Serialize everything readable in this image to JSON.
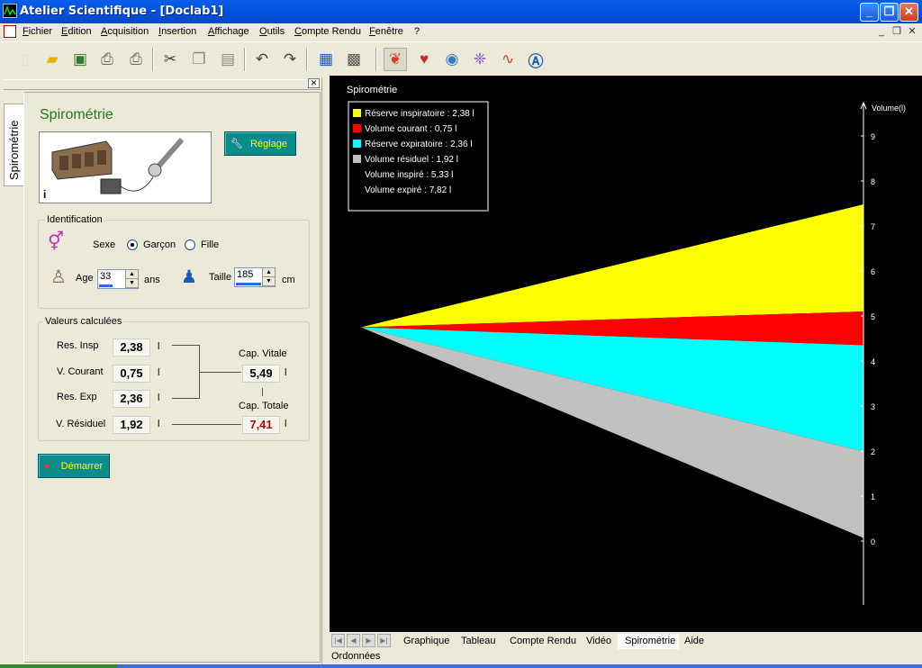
{
  "window": {
    "title": "Atelier Scientifique - [Doclab1]"
  },
  "menu": [
    "Fichier",
    "Edition",
    "Acquisition",
    "Insertion",
    "Affichage",
    "Outils",
    "Compte Rendu",
    "Fenêtre",
    "?"
  ],
  "toolbar": {
    "icons": [
      "new-document-icon",
      "open-folder-icon",
      "save-icon",
      "print-icon",
      "print-preview-icon",
      "cut-icon",
      "copy-icon",
      "paste-icon",
      "undo-icon",
      "redo-icon",
      "chart-icon",
      "table-icon",
      "lungs-icon",
      "heart-icon",
      "eye-icon",
      "molecule-icon",
      "signal-icon",
      "text-icon"
    ]
  },
  "panel": {
    "tab_label": "Spirométrie",
    "title": "Spirométrie",
    "reglage_label": "Réglage",
    "demarrer_label": "Démarrer"
  },
  "identification": {
    "group_label": "Identification",
    "sexe_label": "Sexe",
    "options": [
      "Garçon",
      "Fille"
    ],
    "selected": "Garçon",
    "age_label": "Age",
    "age_value": "33",
    "age_unit": "ans",
    "taille_label": "Taille",
    "taille_value": "185",
    "taille_unit": "cm"
  },
  "valeurs": {
    "group_label": "Valeurs calculées",
    "unit": "l",
    "res_insp": {
      "label": "Res. Insp",
      "value": "2,38"
    },
    "v_courant": {
      "label": "V. Courant",
      "value": "0,75"
    },
    "res_exp": {
      "label": "Res. Exp",
      "value": "2,36"
    },
    "v_residuel": {
      "label": "V. Résiduel",
      "value": "1,92"
    },
    "cap_vitale": {
      "label": "Cap. Vitale",
      "value": "5,49"
    },
    "cap_totale": {
      "label": "Cap. Totale",
      "value": "7,41"
    }
  },
  "chart_data": {
    "type": "area",
    "title": "Spirométrie",
    "ylabel": "Volume(l)",
    "ylim": [
      0,
      9
    ],
    "yticks": [
      0,
      1,
      2,
      3,
      4,
      5,
      6,
      7,
      8,
      9
    ],
    "legend_position": "top-left",
    "origin_volume": 4.75,
    "series": [
      {
        "name": "Réserve inspiratoire : 2,38 l",
        "color": "#ffff00",
        "from": 5.1,
        "to": 7.48
      },
      {
        "name": "Volume courant : 0,75 l",
        "color": "#ff0000",
        "from": 4.35,
        "to": 5.1
      },
      {
        "name": "Réserve expiratoire : 2,36 l",
        "color": "#00ffff",
        "from": 1.99,
        "to": 4.35
      },
      {
        "name": "Volume résiduel : 1,92 l",
        "color": "#c0c0c0",
        "from": 0.07,
        "to": 1.99
      }
    ],
    "extra_legend": [
      "Volume inspiré : 5,33 l",
      "Volume expiré : 7,82 l"
    ]
  },
  "tabs": [
    "Graphique",
    "Tableau",
    "Compte Rendu",
    "Vidéo",
    "Spirométrie",
    "Aide"
  ],
  "active_tab": "Spirométrie",
  "status": "Ordonnées"
}
